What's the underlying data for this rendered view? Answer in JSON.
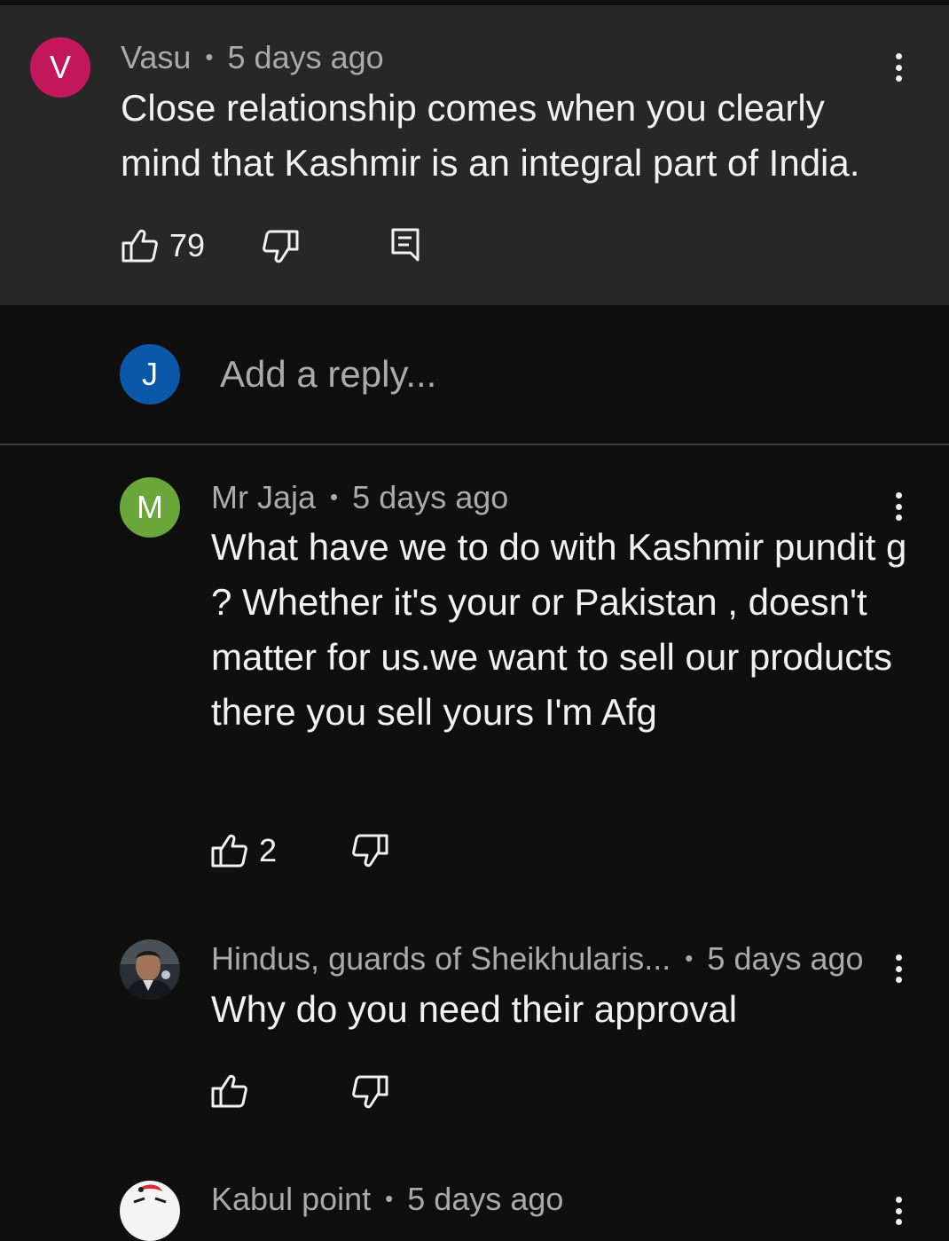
{
  "comment": {
    "avatar_letter": "V",
    "avatar_color": "#c2185b",
    "author": "Vasu",
    "separator": "•",
    "time": "5 days ago",
    "text": "Close relationship comes when you clearly mind that Kashmir is an integral part of India.",
    "likes": "79"
  },
  "reply_box": {
    "avatar_letter": "J",
    "avatar_color": "#0b57a8",
    "placeholder": "Add a reply..."
  },
  "replies": [
    {
      "avatar_letter": "M",
      "avatar_color": "#6aa63a",
      "author": "Mr Jaja",
      "separator": "•",
      "time": "5 days ago",
      "text": "What have we to do with Kashmir pundit g ? Whether it's your or Pakistan , doesn't matter for us.we want to sell our products there you sell yours I'm Afg",
      "likes": "2"
    },
    {
      "author": "Hindus, guards of Sheikhularis...",
      "separator": "•",
      "time": "5 days ago",
      "text": "Why do you need their approval",
      "likes": ""
    },
    {
      "author": "Kabul point",
      "separator": "•",
      "time": "5 days ago"
    }
  ],
  "icons": [
    "thumb-up-icon",
    "thumb-down-icon",
    "reply-icon",
    "more-vert-icon"
  ]
}
